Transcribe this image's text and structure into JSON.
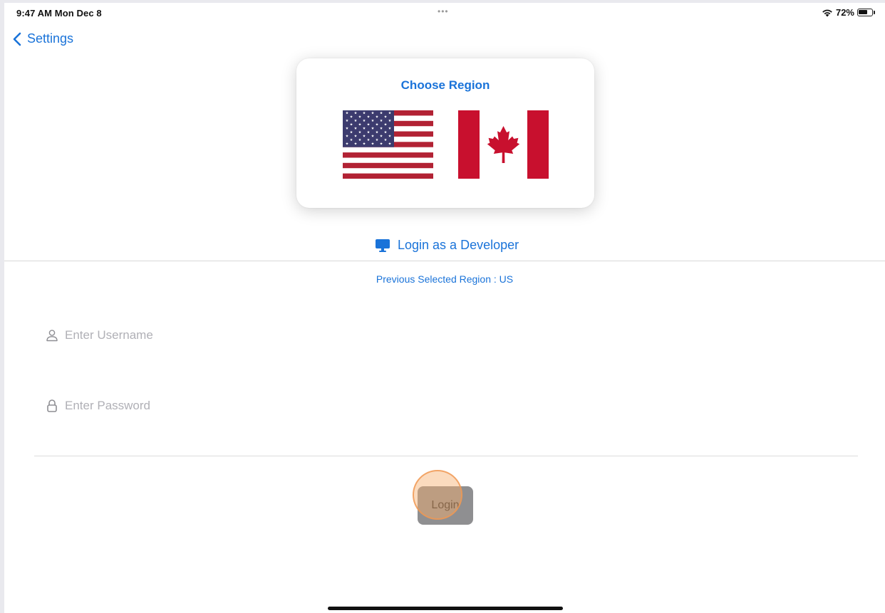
{
  "status_bar": {
    "time": "9:47 AM  Mon Dec 8",
    "dots": "•••",
    "battery_label": "72%",
    "battery_level": 0.72
  },
  "nav": {
    "back_label": "Settings"
  },
  "region_picker": {
    "title": "Choose Region",
    "flags": [
      "us-flag-icon",
      "canada-flag-icon"
    ]
  },
  "developer_login": {
    "label": "Login as a Developer",
    "icon": "monitor-icon"
  },
  "previous_region": {
    "text": "Previous Selected Region : US"
  },
  "form": {
    "username_placeholder": "Enter Username",
    "username_value": "",
    "password_placeholder": "Enter Password",
    "password_value": "",
    "login_label": "Login"
  },
  "colors": {
    "accent": "#1a73d9",
    "button_bg": "#8f8f91",
    "tap_indicator": "#f7af6e"
  }
}
